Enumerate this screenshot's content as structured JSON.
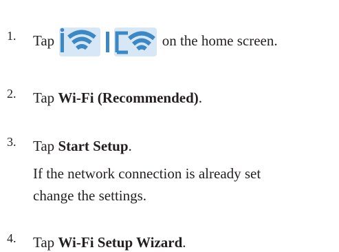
{
  "steps": [
    {
      "number": "1.",
      "before": "Tap",
      "icon": "wifi-status-icons",
      "after": "on the home screen."
    },
    {
      "number": "2.",
      "before": "Tap",
      "bold": "Wi-Fi (Recommended)",
      "after": "."
    },
    {
      "number": "3.",
      "before": "Tap",
      "bold": "Start Setup",
      "after": ".",
      "note_line1": "If the network connection is already set",
      "note_line2": "change the settings."
    },
    {
      "number": "4.",
      "before": "Tap",
      "bold": "Wi-Fi Setup Wizard",
      "after": "."
    }
  ],
  "colors": {
    "text": "#231f20",
    "icon_blue": "#3b88c4",
    "icon_light": "#d7e7f5"
  }
}
